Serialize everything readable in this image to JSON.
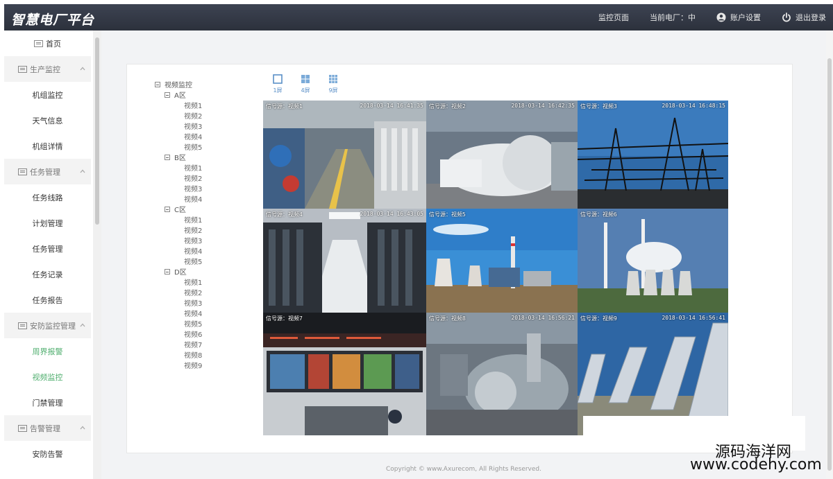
{
  "header": {
    "brand": "智慧电厂平台",
    "nav": [
      {
        "label": "监控页面"
      },
      {
        "label": "当前电厂：中"
      },
      {
        "label": "账户设置"
      },
      {
        "label": "退出登录"
      }
    ]
  },
  "sidebar": {
    "home": "首页",
    "groups": [
      {
        "label": "生产监控",
        "items": [
          "机组监控",
          "天气信息",
          "机组详情"
        ]
      },
      {
        "label": "任务管理",
        "items": [
          "任务线路",
          "计划管理",
          "任务管理",
          "任务记录",
          "任务报告"
        ]
      },
      {
        "label": "安防监控管理",
        "items": [
          "周界报警",
          "视频监控",
          "门禁管理"
        ]
      },
      {
        "label": "告警管理",
        "items": [
          "安防告警"
        ]
      }
    ],
    "active_item": "视频监控"
  },
  "tree": {
    "root": "视频监控",
    "zones": [
      {
        "label": "A区",
        "leaves": [
          "视频1",
          "视频2",
          "视频3",
          "视频4",
          "视频5"
        ]
      },
      {
        "label": "B区",
        "leaves": [
          "视频1",
          "视频2",
          "视频3",
          "视频4"
        ]
      },
      {
        "label": "C区",
        "leaves": [
          "视频1",
          "视频2",
          "视频3",
          "视频4",
          "视频5"
        ]
      },
      {
        "label": "D区",
        "leaves": [
          "视频1",
          "视频2",
          "视频3",
          "视频4",
          "视频5",
          "视频6",
          "视频7",
          "视频8",
          "视频9"
        ]
      }
    ]
  },
  "layouts": [
    {
      "label": "1屏",
      "icon": "single-screen-icon"
    },
    {
      "label": "4屏",
      "icon": "quad-screen-icon"
    },
    {
      "label": "9屏",
      "icon": "nine-screen-icon"
    }
  ],
  "videos": [
    {
      "source": "信号源：视频1",
      "time": "2018-03-14 16:41:35",
      "scene": "pump-hall"
    },
    {
      "source": "信号源：视频2",
      "time": "2018-03-14 16:42:35",
      "scene": "turbine-hall"
    },
    {
      "source": "信号源：视频3",
      "time": "2018-03-14 16:48:15",
      "scene": "substation"
    },
    {
      "source": "信号源：视频4",
      "time": "2018-03-14 16:43:05",
      "scene": "server-room"
    },
    {
      "source": "信号源：视频5",
      "time": "",
      "scene": "power-plant-day"
    },
    {
      "source": "信号源：视频6",
      "time": "",
      "scene": "cooling-towers"
    },
    {
      "source": "信号源：视频7",
      "time": "",
      "scene": "control-room"
    },
    {
      "source": "信号源：视频8",
      "time": "2018-03-14 16:56:21",
      "scene": "generator"
    },
    {
      "source": "信号源：视频9",
      "time": "2018-03-14 16:56:41",
      "scene": "solar-panels"
    }
  ],
  "footer": "Copyright © www.Axurecom, All Rights Reserved.",
  "watermark": {
    "line1": "源码海洋网",
    "line2": "www.codehy.com"
  },
  "colors": {
    "topbar": "#353a46",
    "active": "#4fae6e",
    "layout_icon": "#5a8fc7"
  }
}
